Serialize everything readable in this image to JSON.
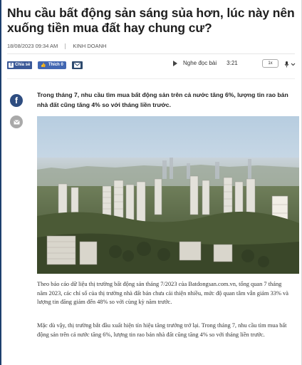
{
  "article": {
    "title": "Nhu cầu bất động sản sáng sủa hơn, lúc này nên xuống tiền mua đất hay chung cư?",
    "datetime": "18/08/2023 09:34 AM",
    "category": "KINH DOANH",
    "lead": "Trong tháng 7, nhu cầu tìm mua bất động sản trên cả nước tăng 6%, lượng tin rao bán nhà đất cũng tăng 4% so với tháng liền trước.",
    "paragraphs": [
      "Theo báo cáo dữ liệu thị trường bất động sản tháng 7/2023 của Batdongsan.com.vn, tổng quan 7 tháng năm 2023, các chỉ số của thị trường nhà đất bán chưa cải thiện nhiều, mức độ quan tâm vẫn giảm 33% và lượng tin đăng giảm đến 48% so với cùng kỳ năm trước.",
      "Mặc dù vậy, thị trường bắt đầu xuất hiện tín hiệu tăng trưởng trở lại. Trong tháng 7, nhu cầu tìm mua bất động sản trên cả nước tăng 6%, lượng tin rao bán nhà đất cũng tăng 4% so với tháng liền trước."
    ]
  },
  "share": {
    "fb_share_label": "Chia sẻ",
    "fb_like_label": "Thích 0",
    "mail_icon": "mail-icon"
  },
  "player": {
    "label": "Nghe đọc bài",
    "duration": "3:21",
    "speed": "1x"
  },
  "side": {
    "fb_letter": "f"
  },
  "colors": {
    "brand_blue": "#3b5998",
    "like_blue": "#4267b2",
    "sidebar_fb": "#2e4d80",
    "frame": "#1d3f6e"
  }
}
